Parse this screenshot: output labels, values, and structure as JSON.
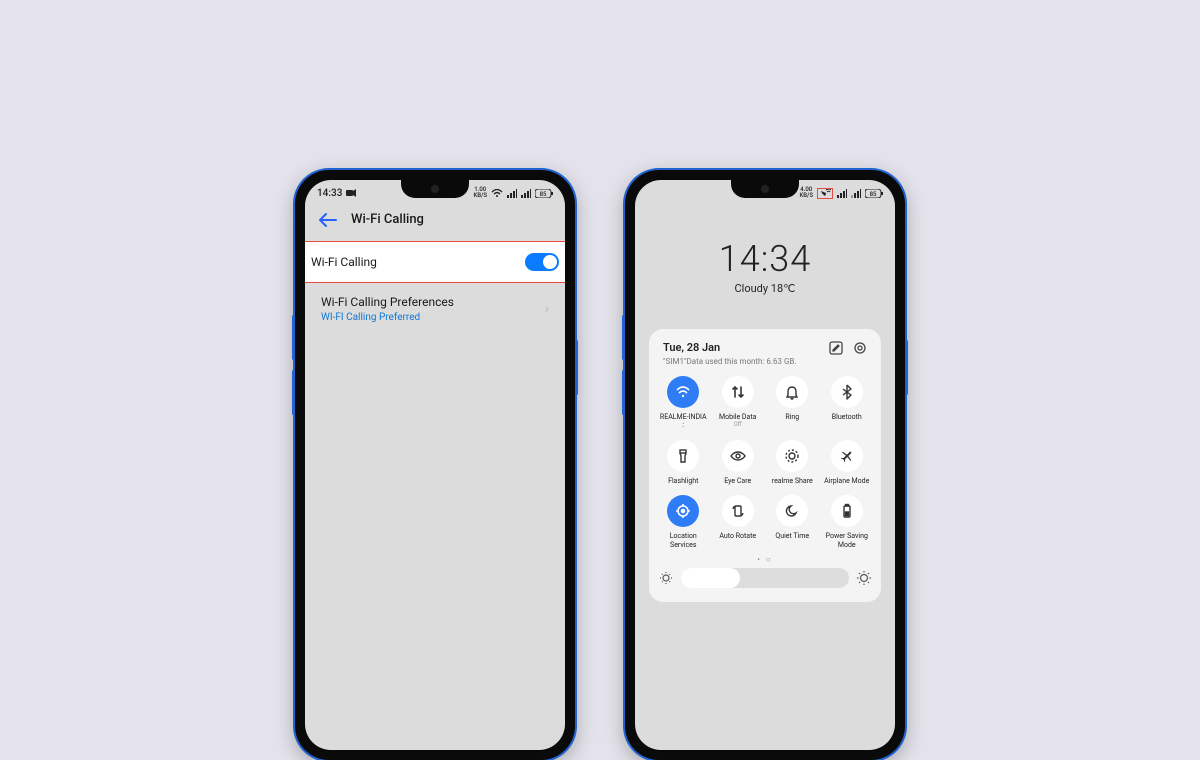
{
  "left": {
    "statusbar": {
      "time": "14:33",
      "netspeed": "1.00",
      "netspeed_unit": "KB/S",
      "battery": "85"
    },
    "header": {
      "title": "Wi-Fi Calling"
    },
    "toggle": {
      "label": "Wi-Fi Calling"
    },
    "pref": {
      "label": "Wi-Fi Calling Preferences",
      "value": "WI-FI Calling Preferred"
    }
  },
  "right": {
    "statusbar": {
      "netspeed": "4.00",
      "netspeed_unit": "KB/S",
      "battery": "85"
    },
    "clock": {
      "time": "14:34",
      "weather": "Cloudy 18℃"
    },
    "panel_head": {
      "date": "Tue, 28 Jan",
      "usage": "\"SIM1\"Data used this month: 6.63 GB."
    },
    "tiles": [
      {
        "label": "REALME-INDIA :",
        "sub": "",
        "active": true,
        "icon": "wifi"
      },
      {
        "label": "Mobile Data",
        "sub": "Off",
        "active": false,
        "icon": "mobile-data"
      },
      {
        "label": "Ring",
        "sub": "",
        "active": false,
        "icon": "bell"
      },
      {
        "label": "Bluetooth",
        "sub": "",
        "active": false,
        "icon": "bluetooth"
      },
      {
        "label": "Flashlight",
        "sub": "",
        "active": false,
        "icon": "flashlight"
      },
      {
        "label": "Eye Care",
        "sub": "",
        "active": false,
        "icon": "eye"
      },
      {
        "label": "realme Share",
        "sub": "",
        "active": false,
        "icon": "share"
      },
      {
        "label": "Airplane Mode",
        "sub": "",
        "active": false,
        "icon": "airplane"
      },
      {
        "label": "Location Services",
        "sub": "",
        "active": true,
        "icon": "location"
      },
      {
        "label": "Auto Rotate",
        "sub": "",
        "active": false,
        "icon": "rotate"
      },
      {
        "label": "Quiet Time",
        "sub": "",
        "active": false,
        "icon": "moon"
      },
      {
        "label": "Power Saving Mode",
        "sub": "",
        "active": false,
        "icon": "battery"
      }
    ]
  }
}
